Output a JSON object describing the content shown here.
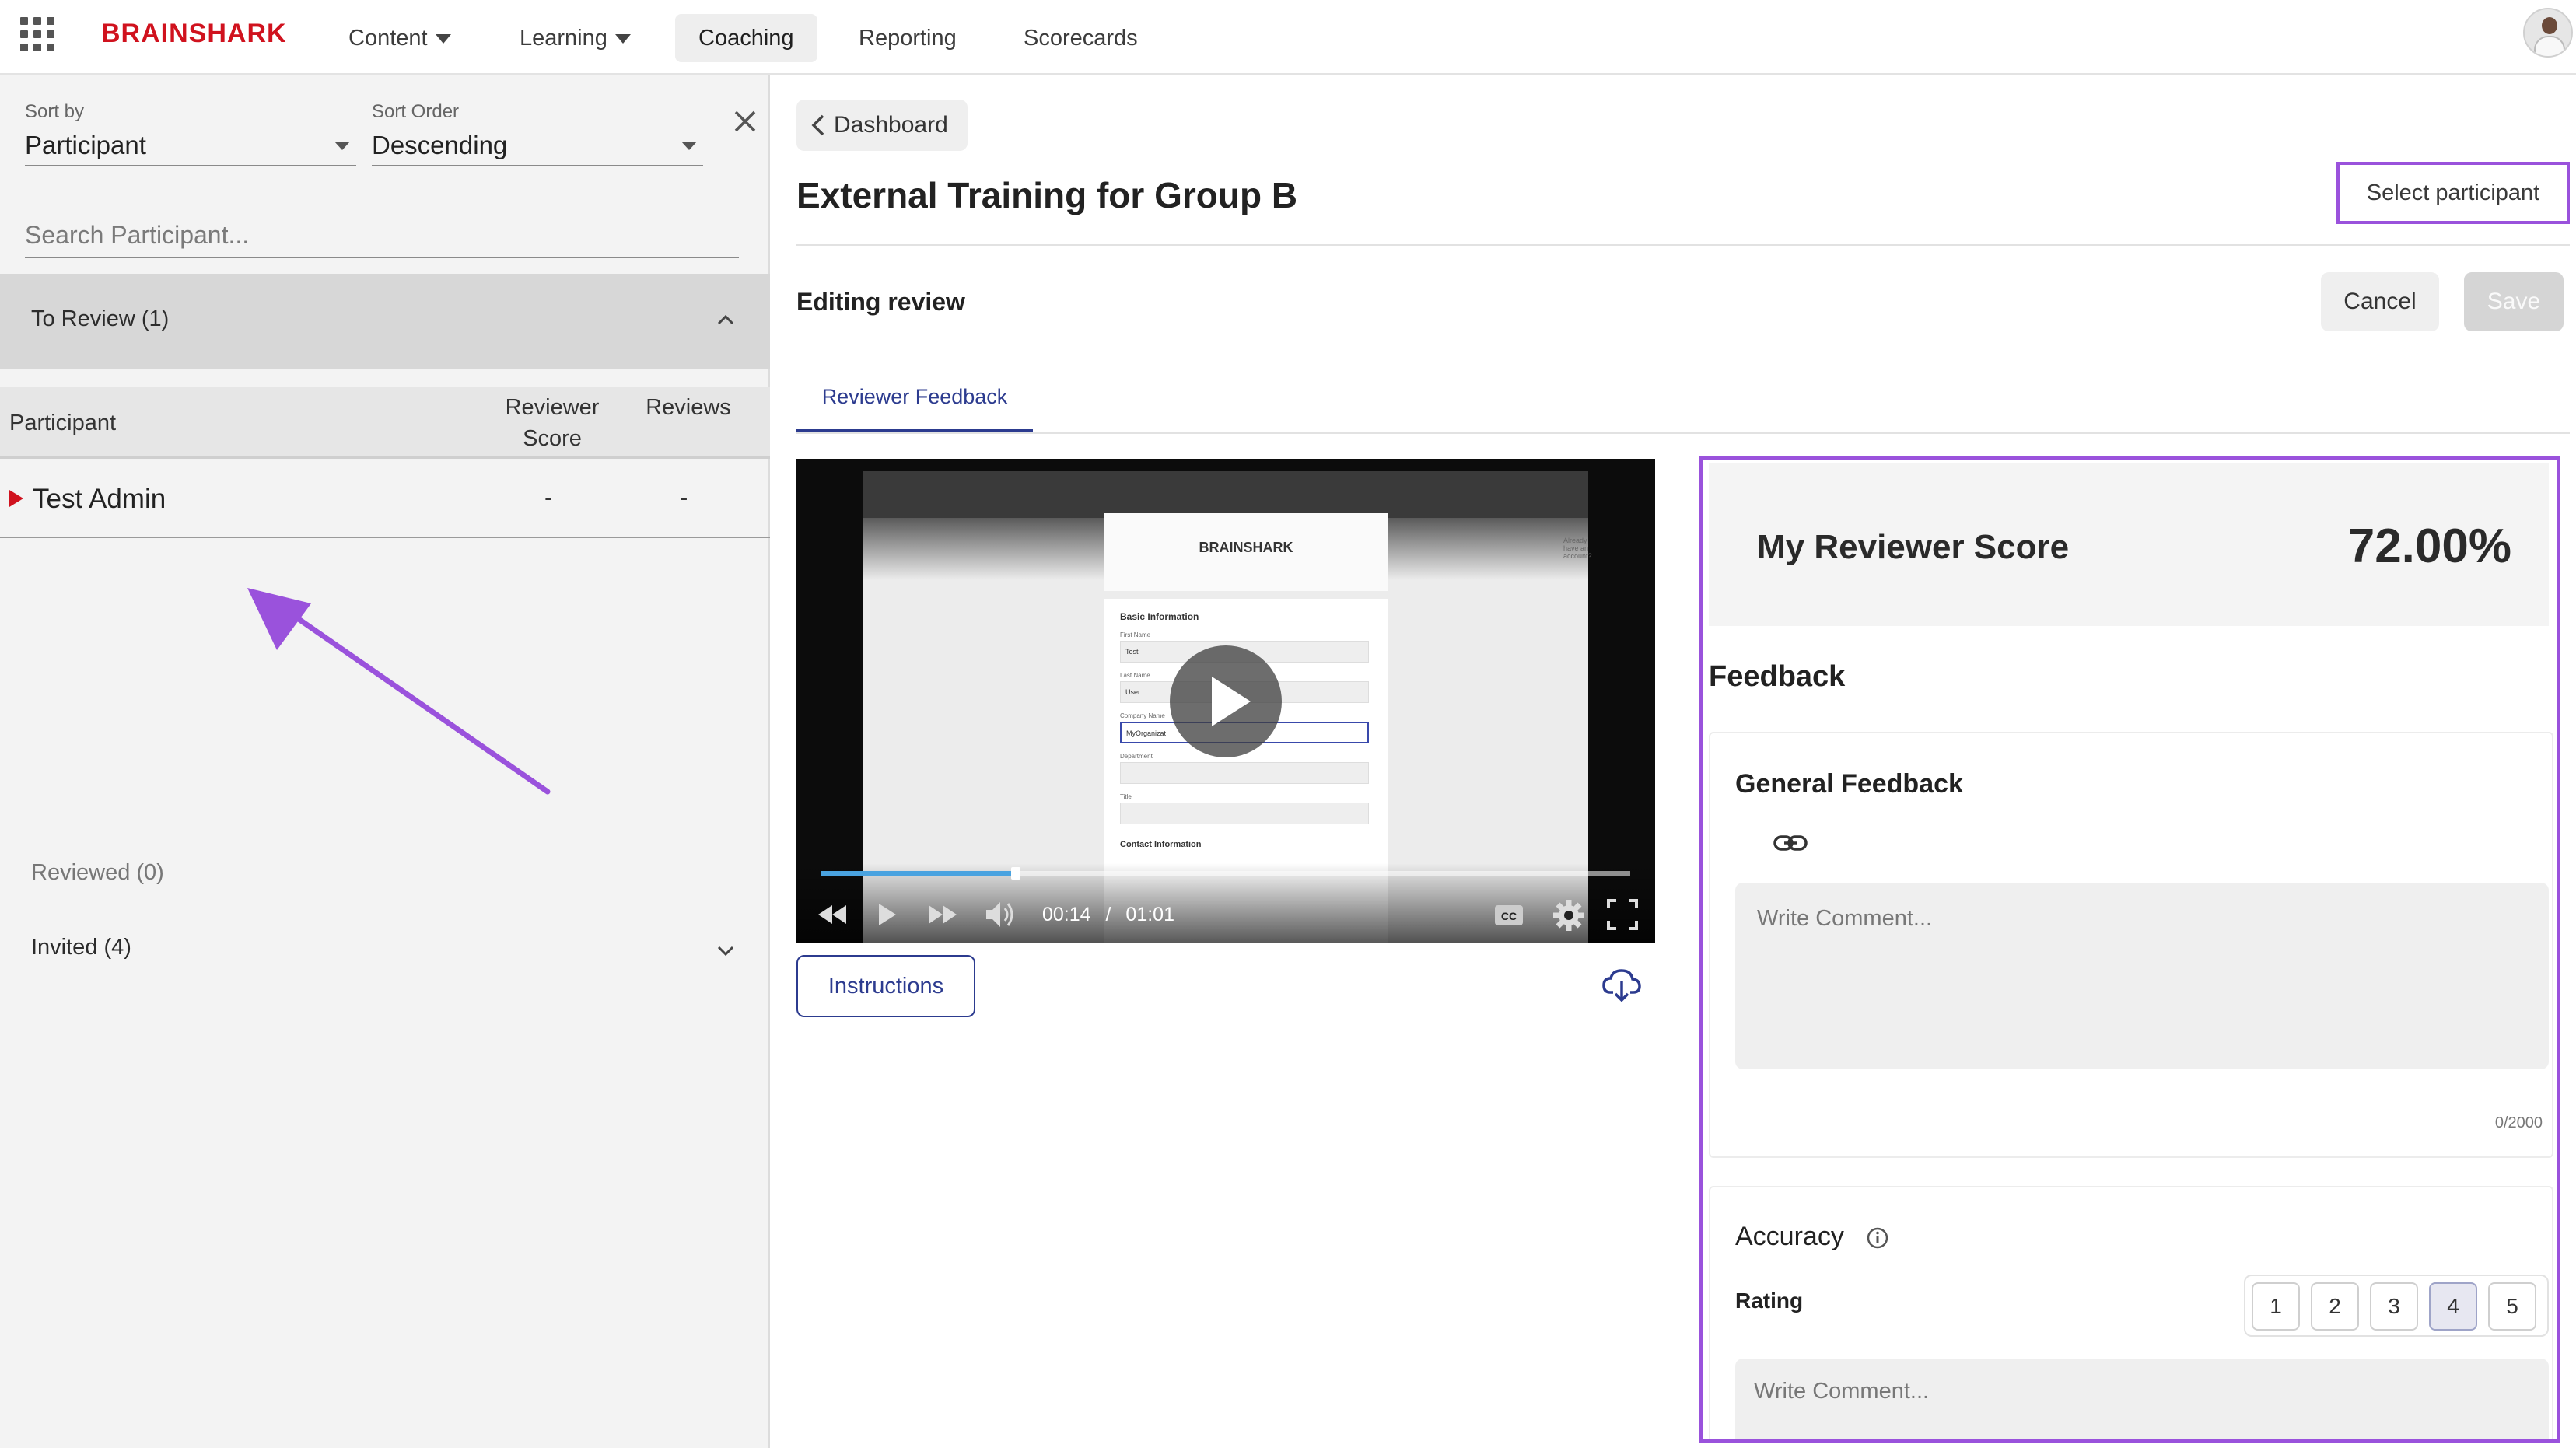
{
  "nav": {
    "logo": "BRAINSHARK",
    "items": [
      {
        "label": "Content",
        "dropdown": true,
        "active": false
      },
      {
        "label": "Learning",
        "dropdown": true,
        "active": false
      },
      {
        "label": "Coaching",
        "dropdown": false,
        "active": true
      },
      {
        "label": "Reporting",
        "dropdown": false,
        "active": false
      },
      {
        "label": "Scorecards",
        "dropdown": false,
        "active": false
      }
    ]
  },
  "sidebar": {
    "sort_by_label": "Sort by",
    "sort_by_value": "Participant",
    "sort_order_label": "Sort Order",
    "sort_order_value": "Descending",
    "search_placeholder": "Search Participant...",
    "to_review_label": "To Review (1)",
    "columns": {
      "participant": "Participant",
      "reviewer_score": "Reviewer Score",
      "reviews": "Reviews"
    },
    "rows": [
      {
        "participant": "Test Admin",
        "reviewer_score": "-",
        "reviews": "-"
      }
    ],
    "reviewed_label": "Reviewed (0)",
    "invited_label": "Invited (4)"
  },
  "main": {
    "back_label": "Dashboard",
    "title": "External Training for Group B",
    "select_participant_label": "Select participant",
    "editing_label": "Editing review",
    "cancel_label": "Cancel",
    "save_label": "Save",
    "tab_label": "Reviewer Feedback",
    "instructions_label": "Instructions"
  },
  "video": {
    "current_time": "00:14",
    "separator": "/",
    "duration": "01:01",
    "progress_fraction": 0.24,
    "screen": {
      "logo": "BRAINSHARK",
      "section": "Basic Information",
      "first_name_label": "First Name",
      "first_name_value": "Test",
      "last_name_label": "Last Name",
      "last_name_value": "User",
      "company_label": "Company Name",
      "company_value": "MyOrganizat",
      "department_label": "Department",
      "title_label": "Title",
      "contact_label": "Contact Information",
      "corner_text": "Already have an account?"
    }
  },
  "review": {
    "score_label": "My Reviewer Score",
    "score_value": "72.00%",
    "feedback_heading": "Feedback",
    "general_feedback_title": "General Feedback",
    "comment_placeholder": "Write Comment...",
    "char_counter": "0/2000",
    "accuracy_title": "Accuracy",
    "rating_label": "Rating",
    "rating_options": [
      "1",
      "2",
      "3",
      "4",
      "5"
    ],
    "selected_rating": "4",
    "accuracy_comment_placeholder": "Write Comment..."
  },
  "colors": {
    "brand_red": "#d0121e",
    "accent_navy": "#2c3b8f",
    "annotation_purple": "#9a52dc"
  }
}
